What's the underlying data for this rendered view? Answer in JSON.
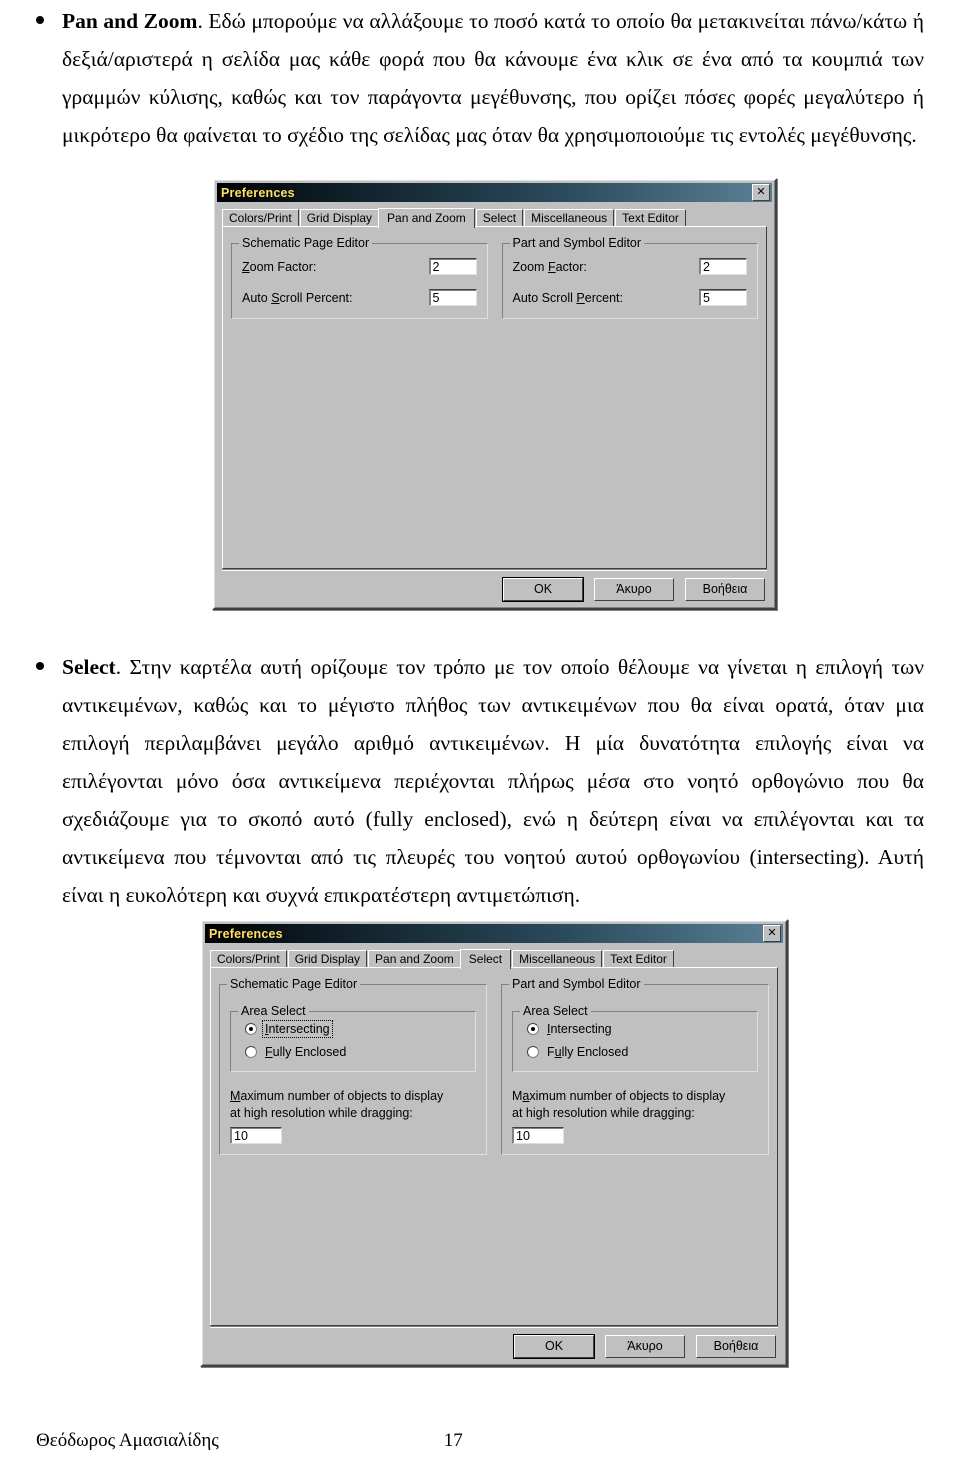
{
  "document": {
    "paragraph1": {
      "lead": "Pan and Zoom",
      "text": ". Εδώ μπορούμε να αλλάξουμε το ποσό κατά το οποίο θα μετακινείται πάνω/κάτω ή δεξιά/αριστερά η σελίδα μας κάθε φορά που θα κάνουμε ένα κλικ σε ένα από τα κουμπιά των γραμμών κύλισης, καθώς και τον παράγοντα μεγέθυνσης, που ορίζει πόσες φορές μεγαλύτερο ή μικρότερο θα φαίνεται το σχέδιο της σελίδας μας όταν θα χρησιμοποιούμε τις εντολές μεγέθυνσης."
    },
    "paragraph2": {
      "lead": "Select",
      "text": ". Στην καρτέλα αυτή ορίζουμε τον τρόπο με τον οποίο θέλουμε να γίνεται η επιλογή των αντικειμένων, καθώς και το μέγιστο πλήθος των αντικειμένων που θα είναι ορατά, όταν μια επιλογή περιλαμβάνει μεγάλο αριθμό αντικειμένων. Η μία δυνατότητα επιλογής είναι να επιλέγονται μόνο όσα αντικείμενα περιέχονται πλήρως μέσα στο νοητό ορθογώνιο που θα σχεδιάζουμε για το σκοπό αυτό (fully enclosed), ενώ η δεύτερη είναι να επιλέγονται και τα αντικείμενα που τέμνονται από τις πλευρές του νοητού αυτού ορθογωνίου (intersecting). Αυτή είναι η ευκολότερη και συχνά επικρατέστερη αντιμετώπιση."
    }
  },
  "footer": {
    "author": "Θεόδωρος Αμασιαλίδης",
    "page_number": "17"
  },
  "colors": {
    "dialog_face": "#c0c0c0",
    "titlebar_text": "#ffe062",
    "titlebar_gradient_start": "#000000",
    "titlebar_gradient_end": "#5b8095",
    "field_bg": "#ffffff"
  },
  "dialog_pan_and_zoom": {
    "title": "Preferences",
    "close_label": "✕",
    "tabs": [
      {
        "label": "Colors/Print",
        "active": false
      },
      {
        "label": "Grid Display",
        "active": false
      },
      {
        "label": "Pan and Zoom",
        "active": true
      },
      {
        "label": "Select",
        "active": false
      },
      {
        "label": "Miscellaneous",
        "active": false
      },
      {
        "label": "Text Editor",
        "active": false
      }
    ],
    "groups": [
      {
        "title": "Schematic Page Editor",
        "fields": [
          {
            "label": "Zoom Factor:",
            "accel": "Z",
            "value": "2"
          },
          {
            "label": "Auto Scroll Percent:",
            "accel": "S",
            "value": "5"
          }
        ]
      },
      {
        "title": "Part and Symbol Editor",
        "fields": [
          {
            "label": "Zoom Factor:",
            "accel": "F",
            "value": "2"
          },
          {
            "label": "Auto Scroll Percent:",
            "accel": "P",
            "value": "5"
          }
        ]
      }
    ],
    "buttons": [
      {
        "label": "OK",
        "default": true
      },
      {
        "label": "Άκυρο",
        "default": false
      },
      {
        "label": "Βοήθεια",
        "default": false
      }
    ]
  },
  "dialog_select": {
    "title": "Preferences",
    "close_label": "✕",
    "tabs": [
      {
        "label": "Colors/Print",
        "active": false
      },
      {
        "label": "Grid Display",
        "active": false
      },
      {
        "label": "Pan and Zoom",
        "active": false
      },
      {
        "label": "Select",
        "active": true
      },
      {
        "label": "Miscellaneous",
        "active": false
      },
      {
        "label": "Text Editor",
        "active": false
      }
    ],
    "groups": [
      {
        "title": "Schematic Page Editor",
        "area_select_title": "Area Select",
        "options": [
          {
            "label": "Intersecting",
            "checked": true,
            "focused": true
          },
          {
            "label": "Fully Enclosed",
            "checked": false,
            "focused": false
          }
        ],
        "max_objects_label_line1": "Maximum number of objects to display",
        "max_objects_label_line2": "at high resolution while dragging:",
        "max_objects_value": "10"
      },
      {
        "title": "Part and Symbol Editor",
        "area_select_title": "Area Select",
        "options": [
          {
            "label": "Intersecting",
            "checked": true,
            "focused": false
          },
          {
            "label": "Fully Enclosed",
            "checked": false,
            "focused": false
          }
        ],
        "max_objects_label_line1": "Maximum number of objects to display",
        "max_objects_label_line2": "at high resolution while dragging:",
        "max_objects_value": "10"
      }
    ],
    "buttons": [
      {
        "label": "OK",
        "default": true
      },
      {
        "label": "Άκυρο",
        "default": false
      },
      {
        "label": "Βοήθεια",
        "default": false
      }
    ]
  }
}
